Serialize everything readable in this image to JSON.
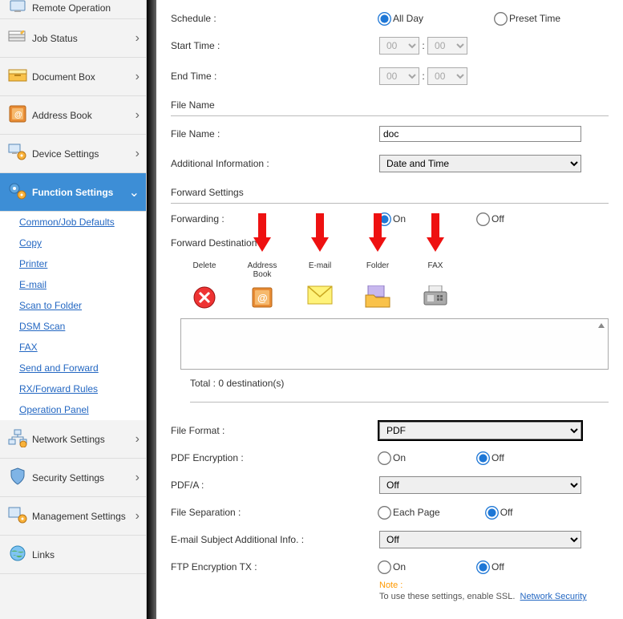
{
  "sidebar": {
    "items": [
      {
        "label": "Remote Operation"
      },
      {
        "label": "Job Status"
      },
      {
        "label": "Document Box"
      },
      {
        "label": "Address Book"
      },
      {
        "label": "Device Settings"
      },
      {
        "label": "Function Settings"
      },
      {
        "label": "Network Settings"
      },
      {
        "label": "Security Settings"
      },
      {
        "label": "Management Settings"
      },
      {
        "label": "Links"
      }
    ],
    "sub": [
      "Common/Job Defaults",
      "Copy",
      "Printer",
      "E-mail",
      "Scan to Folder",
      "DSM Scan",
      "FAX",
      "Send and Forward",
      "RX/Forward Rules",
      "Operation Panel"
    ]
  },
  "schedule": {
    "label": "Schedule :",
    "all_day": "All Day",
    "preset_time": "Preset Time",
    "start": "Start Time :",
    "end": "End Time :",
    "h": "00",
    "m": "00"
  },
  "filename": {
    "section": "File Name",
    "label": "File Name :",
    "value": "doc",
    "addl_label": "Additional Information :",
    "addl_value": "Date and Time"
  },
  "forward": {
    "section": "Forward Settings",
    "fwd_label": "Forwarding :",
    "on": "On",
    "off": "Off",
    "dest_label": "Forward Destination :",
    "cols": [
      "Delete",
      "Address Book",
      "E-mail",
      "Folder",
      "FAX"
    ],
    "total": "Total  :  0 destination(s)"
  },
  "fmt": {
    "file_format_label": "File Format :",
    "file_format_value": "PDF",
    "pdf_enc_label": "PDF Encryption :",
    "pdfa_label": "PDF/A :",
    "pdfa_value": "Off",
    "file_sep_label": "File Separation :",
    "sep_each": "Each Page",
    "sep_off": "Off",
    "subj_label": "E-mail Subject Additional Info. :",
    "subj_value": "Off",
    "ftp_label": "FTP Encryption TX :",
    "on": "On",
    "off": "Off",
    "note": "Note :",
    "note2": "To use these settings, enable SSL.",
    "note_link": "Network Security"
  }
}
